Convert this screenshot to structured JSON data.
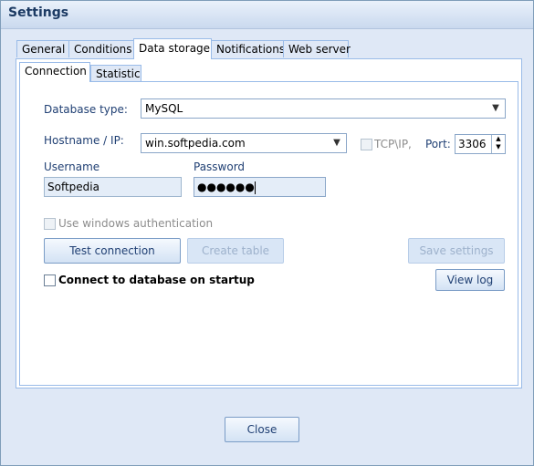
{
  "window": {
    "title": "Settings"
  },
  "tabs": [
    "General",
    "Conditions",
    "Data storage",
    "Notifications",
    "Web server"
  ],
  "subtabs": [
    "Connection",
    "Statistic"
  ],
  "form": {
    "db_type_label": "Database type:",
    "db_type_value": "MySQL",
    "hostname_label": "Hostname / IP:",
    "hostname_value": "win.softpedia.com",
    "tcpip_label": "TCP\\IP,",
    "port_label": "Port:",
    "port_value": "3306",
    "username_label": "Username",
    "username_value": "Softpedia",
    "password_label": "Password",
    "password_value": "●●●●●●",
    "win_auth_label": "Use windows authentication",
    "connect_startup_label": "Connect to database on startup"
  },
  "buttons": {
    "test_connection": "Test connection",
    "create_table": "Create table",
    "save_settings": "Save settings",
    "view_log": "View log",
    "close": "Close"
  }
}
